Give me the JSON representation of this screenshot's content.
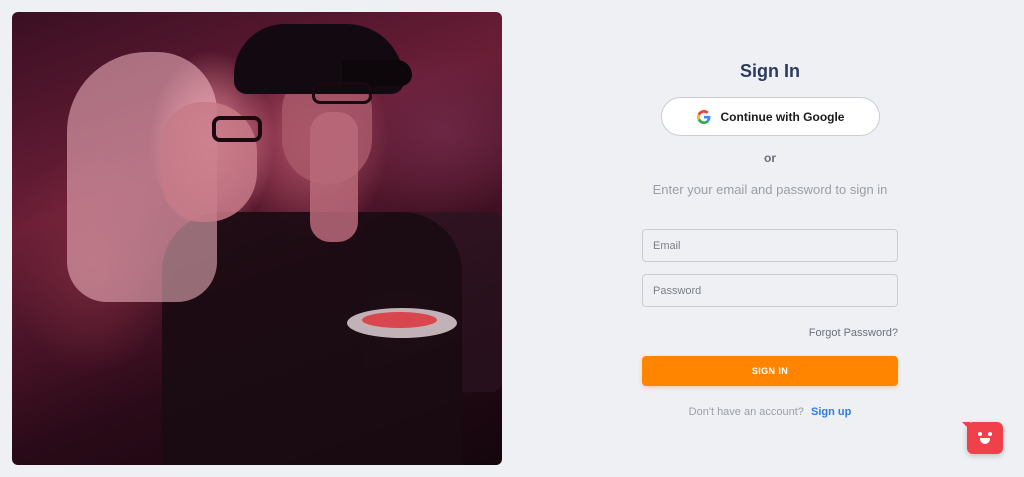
{
  "signin": {
    "title": "Sign In",
    "google_label": "Continue with Google",
    "or_label": "or",
    "subtitle": "Enter your email and password to sign in",
    "email_placeholder": "Email",
    "password_placeholder": "Password",
    "forgot_label": "Forgot Password?",
    "submit_label": "SIGN IN",
    "no_account_text": "Don't have an account?",
    "signup_label": "Sign up"
  },
  "colors": {
    "accent": "#ff8500",
    "link": "#2d7be5",
    "title": "#2e3a5c",
    "chat_widget": "#f0404a"
  },
  "icons": {
    "google": "google-g-icon",
    "chat": "chat-bot-icon"
  }
}
